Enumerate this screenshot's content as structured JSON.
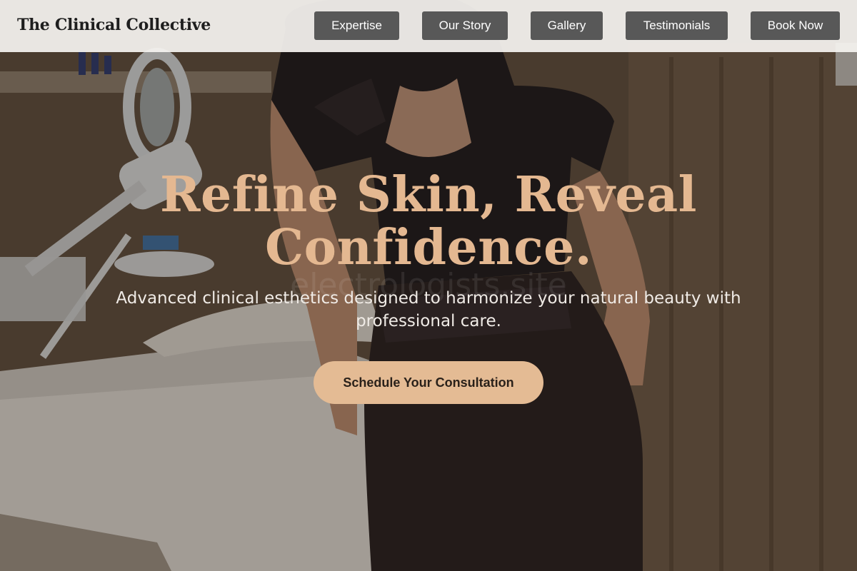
{
  "brand": {
    "name": "The Clinical Collective"
  },
  "nav": {
    "items": [
      {
        "label": "Expertise"
      },
      {
        "label": "Our Story"
      },
      {
        "label": "Gallery"
      },
      {
        "label": "Testimonials"
      },
      {
        "label": "Book Now"
      }
    ]
  },
  "hero": {
    "headline_line1": "Refine Skin, Reveal",
    "headline_line2": "Confidence.",
    "subtext": "Advanced clinical esthetics designed to harmonize your natural beauty with professional care.",
    "cta_label": "Schedule Your Consultation",
    "watermark": "electrologists.site",
    "image_alt": "Esthetician leaning on a treatment bed in a clinical skincare room"
  },
  "colors": {
    "accent": "#e4b891",
    "cta_bg": "#e4bb94",
    "nav_button_bg": "#585858",
    "nav_bg": "#f5f3f0"
  }
}
